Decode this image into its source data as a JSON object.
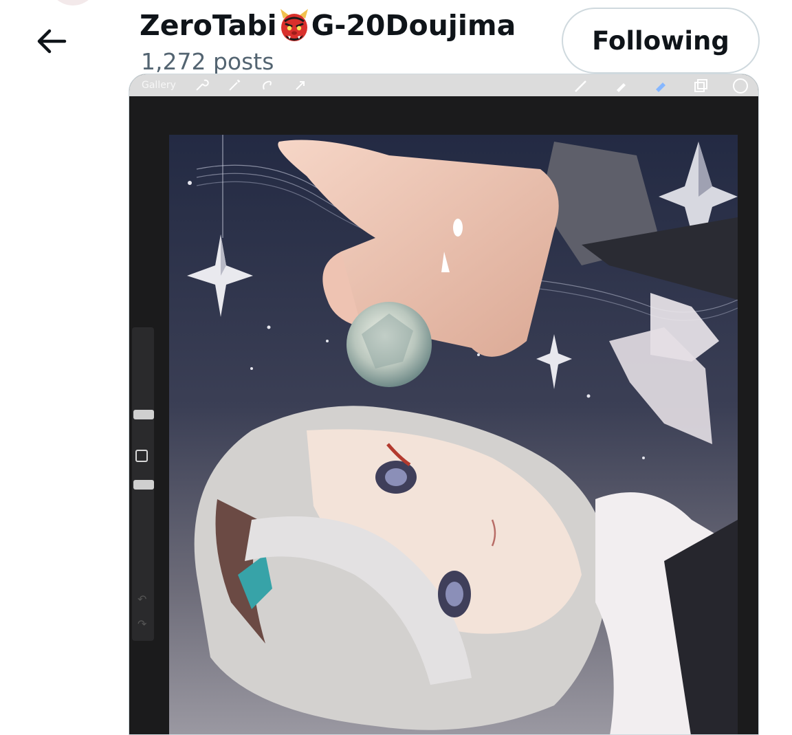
{
  "header": {
    "profile_name_before": "ZeroTabi",
    "profile_name_after": "G-20Doujima",
    "name_emoji_icon": "japanese-ogre-icon",
    "post_count": "1,272 posts",
    "follow_button_label": "Following"
  },
  "media": {
    "app_toolbar_label": "Gallery",
    "toolbar_icons": [
      "wrench-icon",
      "magic-wand-icon",
      "selection-icon",
      "transform-arrow-icon",
      "brush-icon",
      "smudge-icon",
      "eraser-icon",
      "layers-icon",
      "color-circle-icon"
    ],
    "undo_glyph": "↶",
    "redo_glyph": "↷"
  },
  "colors": {
    "text_primary": "#0f1419",
    "text_secondary": "#536471",
    "border": "#cfd9de",
    "canvas_frame": "#1b1b1c",
    "night_sky": "#22273a"
  }
}
